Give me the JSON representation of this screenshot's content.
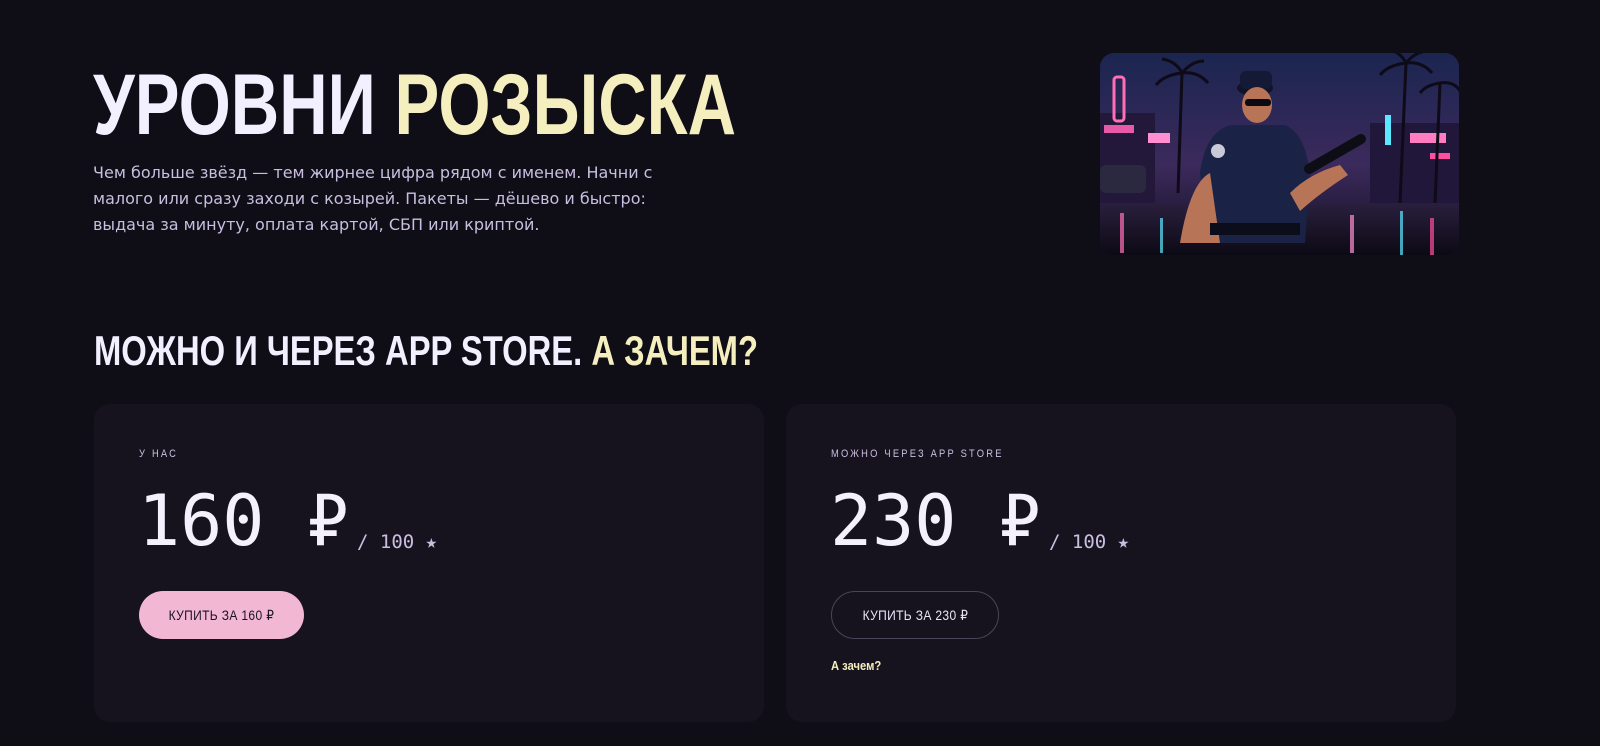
{
  "hero": {
    "title_part1": "УРОВНИ ",
    "title_part2": "РОЗЫСКА",
    "description": "Чем больше звёзд — тем жирнее цифра рядом с именем. Начни с малого или сразу заходи с козырей. Пакеты — дёшево и быстро: выдача за минуту, оплата картой, СБП или криптой.",
    "image_icon": "police-officer-neon-street-image"
  },
  "section": {
    "title_part1": "МОЖНО И ЧЕРЕЗ APP STORE. ",
    "title_part2": "А ЗАЧЕМ?"
  },
  "cards": {
    "ours": {
      "label": "У НАС",
      "price": "160 ₽",
      "per": "/ 100 ★",
      "button_label": "КУПИТЬ ЗА 160 ₽"
    },
    "appstore": {
      "label": "МОЖНО ЧЕРЕЗ APP STORE",
      "price": "230 ₽",
      "per": "/ 100 ★",
      "button_label": "КУПИТЬ ЗА 230 ₽",
      "why_link": "А зачем?"
    }
  },
  "colors": {
    "background": "#0f0d16",
    "card": "#16131e",
    "accent_yellow": "#f5efc0",
    "button_pink": "#f2b8d3",
    "muted_text": "#c8bfe0"
  }
}
